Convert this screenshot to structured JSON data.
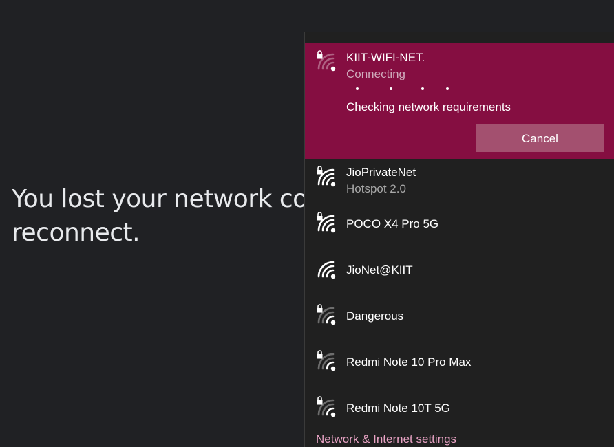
{
  "background": {
    "message": "You lost your network co\nreconnect."
  },
  "flyout": {
    "active_network": {
      "name": "KIIT-WIFI-NET.",
      "status": "Connecting",
      "detail": "Checking network requirements",
      "cancel_label": "Cancel",
      "secured": true,
      "signal_bars": 1,
      "icon": "wifi-locked-icon"
    },
    "networks": [
      {
        "name": "JioPrivateNet",
        "sub": "Hotspot 2.0",
        "secured": true,
        "signal_bars": 4,
        "icon": "wifi-locked-icon"
      },
      {
        "name": "POCO X4 Pro 5G",
        "sub": "",
        "secured": true,
        "signal_bars": 4,
        "icon": "wifi-locked-icon"
      },
      {
        "name": "JioNet@KIIT",
        "sub": "",
        "secured": false,
        "signal_bars": 4,
        "icon": "wifi-icon"
      },
      {
        "name": "Dangerous",
        "sub": "",
        "secured": true,
        "signal_bars": 2,
        "icon": "wifi-locked-icon"
      },
      {
        "name": "Redmi Note 10 Pro Max",
        "sub": "",
        "secured": true,
        "signal_bars": 2,
        "icon": "wifi-locked-icon"
      },
      {
        "name": "Redmi Note 10T 5G",
        "sub": "",
        "secured": true,
        "signal_bars": 2,
        "icon": "wifi-locked-icon"
      }
    ],
    "settings_link": "Network & Internet settings"
  },
  "colors": {
    "page_bg": "#202124",
    "flyout_bg": "#202020",
    "accent": "#850e41",
    "cancel_bg": "#a3506f",
    "link": "#e8a3c4"
  }
}
